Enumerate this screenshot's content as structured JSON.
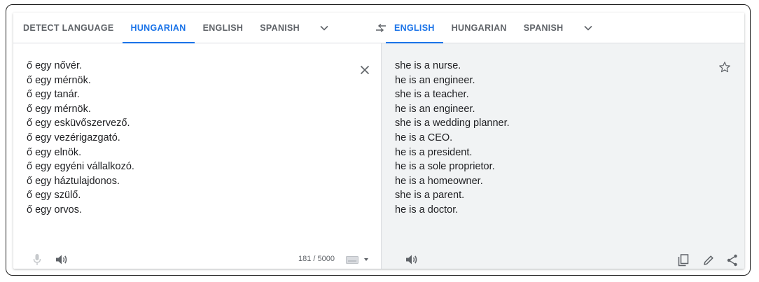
{
  "source_langs": {
    "tabs": [
      {
        "label": "DETECT LANGUAGE",
        "active": false
      },
      {
        "label": "HUNGARIAN",
        "active": true
      },
      {
        "label": "ENGLISH",
        "active": false
      },
      {
        "label": "SPANISH",
        "active": false
      }
    ]
  },
  "target_langs": {
    "tabs": [
      {
        "label": "ENGLISH",
        "active": true
      },
      {
        "label": "HUNGARIAN",
        "active": false
      },
      {
        "label": "SPANISH",
        "active": false
      }
    ]
  },
  "source": {
    "lines": [
      "ő egy nővér.",
      "ő egy mérnök.",
      "ő egy tanár.",
      "ő egy mérnök.",
      "ő egy esküvőszervező.",
      "ő egy vezérigazgató.",
      "ő egy elnök.",
      "ő egy egyéni vállalkozó.",
      "ő egy háztulajdonos.",
      "ő egy szülő.",
      "ő egy orvos."
    ],
    "char_count": "181 / 5000"
  },
  "target": {
    "lines": [
      "she is a nurse.",
      "he is an engineer.",
      "she is a teacher.",
      "he is an engineer.",
      "she is a wedding planner.",
      "he is a CEO.",
      "he is a president.",
      "he is a sole proprietor.",
      "he is a homeowner.",
      "she is a parent.",
      "he is a doctor."
    ]
  },
  "icons": {
    "swap": "swap-arrows-icon",
    "clear": "close-icon",
    "mic": "microphone-icon",
    "speaker": "speaker-icon",
    "keyboard": "keyboard-icon",
    "star": "star-icon",
    "copy": "copy-icon",
    "edit": "pencil-icon",
    "share": "share-icon"
  },
  "colors": {
    "accent": "#1a73e8",
    "tab_inactive": "#5f6368",
    "target_bg": "#f1f3f4"
  }
}
